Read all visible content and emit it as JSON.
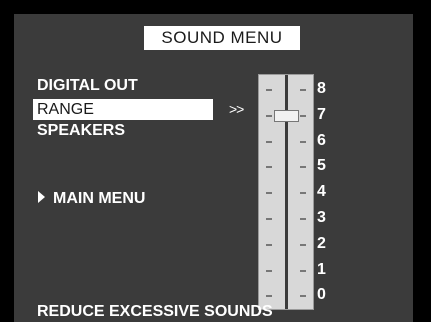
{
  "title": "SOUND MENU",
  "menu": {
    "items": [
      {
        "label": "DIGITAL OUT",
        "selected": false
      },
      {
        "label": "RANGE",
        "selected": true
      },
      {
        "label": "SPEAKERS",
        "selected": false
      }
    ],
    "main_menu": "MAIN MENU",
    "pointer": ">>"
  },
  "slider": {
    "labels": [
      "8",
      "7",
      "6",
      "5",
      "4",
      "3",
      "2",
      "1",
      "0"
    ],
    "min": 0,
    "max": 8,
    "value": 7
  },
  "footer": "REDUCE EXCESSIVE SOUNDS",
  "colors": {
    "panel": "#3b3b3b",
    "highlight": "#ffffff",
    "text": "#ffffff"
  }
}
